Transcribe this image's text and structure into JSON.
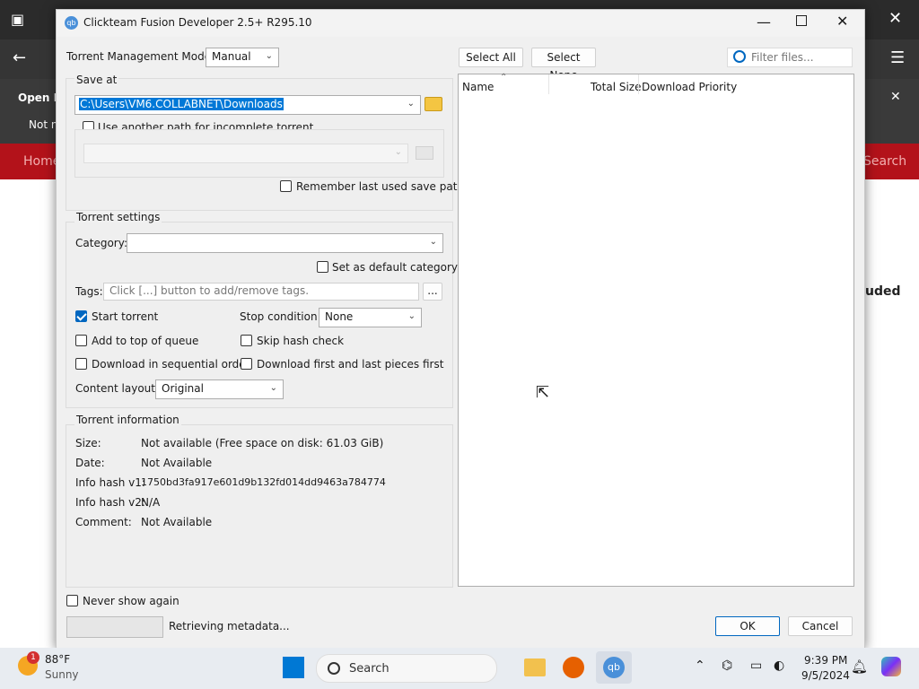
{
  "background": {
    "banner_title": "Open Fi",
    "banner_sub": "Not n",
    "nav_left": "Home",
    "nav_right": "Search",
    "page_partial": "uded"
  },
  "dialog": {
    "title": "Clickteam Fusion Developer 2.5+ R295.10",
    "mode_label": "Torrent Management Mode:",
    "mode_value": "Manual",
    "save_at": {
      "group_label": "Save at",
      "path": "C:\\Users\\VM6.COLLABNET\\Downloads",
      "use_another_path_label": "Use another path for incomplete torrent",
      "remember_label": "Remember last used save path"
    },
    "torrent_settings": {
      "group_label": "Torrent settings",
      "category_label": "Category:",
      "category_value": "",
      "set_default_label": "Set as default category",
      "tags_label": "Tags:",
      "tags_placeholder": "Click [...] button to add/remove tags.",
      "tags_button": "...",
      "start_torrent_label": "Start torrent",
      "stop_condition_label": "Stop condition:",
      "stop_condition_value": "None",
      "add_top_label": "Add to top of queue",
      "skip_hash_label": "Skip hash check",
      "sequential_label": "Download in sequential order",
      "first_last_label": "Download first and last pieces first",
      "content_layout_label": "Content layout:",
      "content_layout_value": "Original"
    },
    "torrent_info": {
      "group_label": "Torrent information",
      "rows": [
        {
          "label": "Size:",
          "value": "Not available (Free space on disk: 61.03 GiB)"
        },
        {
          "label": "Date:",
          "value": "Not Available"
        },
        {
          "label": "Info hash v1:",
          "value": "1750bd3fa917e601d9b132fd014dd9463a784774"
        },
        {
          "label": "Info hash v2:",
          "value": "N/A"
        },
        {
          "label": "Comment:",
          "value": "Not Available"
        }
      ]
    },
    "files": {
      "select_all": "Select All",
      "select_none": "Select None",
      "filter_placeholder": "Filter files...",
      "col_name": "Name",
      "col_size": "Total Size",
      "col_priority": "Download Priority"
    },
    "never_show_label": "Never show again",
    "status": "Retrieving metadata...",
    "ok": "OK",
    "cancel": "Cancel"
  },
  "taskbar": {
    "weather_temp": "88°F",
    "weather_desc": "Sunny",
    "weather_badge": "1",
    "search": "Search",
    "time": "9:39 PM",
    "date": "9/5/2024"
  }
}
